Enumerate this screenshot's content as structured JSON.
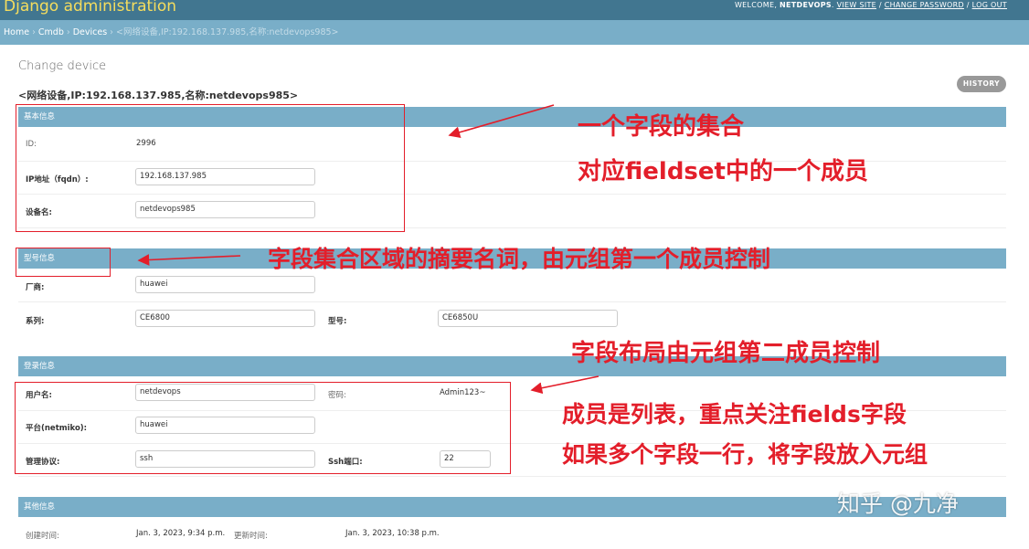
{
  "header": {
    "branding": "Django administration",
    "welcome_prefix": "WELCOME, ",
    "username": "NETDEVOPS",
    "welcome_suffix": ". ",
    "view_site": "VIEW SITE",
    "sep1": " / ",
    "change_password": "CHANGE PASSWORD",
    "sep2": " / ",
    "logout": "LOG OUT"
  },
  "breadcrumbs": {
    "home": "Home",
    "cmdb": "Cmdb",
    "devices": "Devices",
    "current": "<网络设备,IP:192.168.137.985,名称:netdevops985>",
    "sep": " › "
  },
  "page": {
    "title": "Change device",
    "object_title": "<网络设备,IP:192.168.137.985,名称:netdevops985>",
    "history": "HISTORY"
  },
  "fieldsets": {
    "basic": {
      "title": "基本信息",
      "id_label": "ID:",
      "id_value": "2996",
      "ip_label": "IP地址（fqdn）:",
      "ip_value": "192.168.137.985",
      "name_label": "设备名:",
      "name_value": "netdevops985"
    },
    "model": {
      "title": "型号信息",
      "vendor_label": "厂商:",
      "vendor_value": "huawei",
      "series_label": "系列:",
      "series_value": "CE6800",
      "model_label": "型号:",
      "model_value": "CE6850U"
    },
    "login": {
      "title": "登录信息",
      "user_label": "用户名:",
      "user_value": "netdevops",
      "password_label": "密码:",
      "password_value": "Admin123~",
      "platform_label": "平台(netmiko):",
      "platform_value": "huawei",
      "protocol_label": "管理协议:",
      "protocol_value": "ssh",
      "ssh_port_label": "Ssh端口:",
      "ssh_port_value": "22"
    },
    "other": {
      "title": "其他信息",
      "created_label": "创建时间:",
      "created_value": "Jan. 3, 2023, 9:34 p.m.",
      "updated_label": "更新时间:",
      "updated_value": "Jan. 3, 2023, 10:38 p.m."
    }
  },
  "annotations": {
    "a1_line1": "一个字段的集合",
    "a1_line2": "对应fieldset中的一个成员",
    "a2": "字段集合区域的摘要名词，由元组第一个成员控制",
    "a3": "字段布局由元组第二成员控制",
    "a4_line1": "成员是列表，重点关注fields字段",
    "a4_line2": "如果多个字段一行，将字段放入元组",
    "color": "#e31e2a"
  },
  "watermark": "知乎 @九净"
}
